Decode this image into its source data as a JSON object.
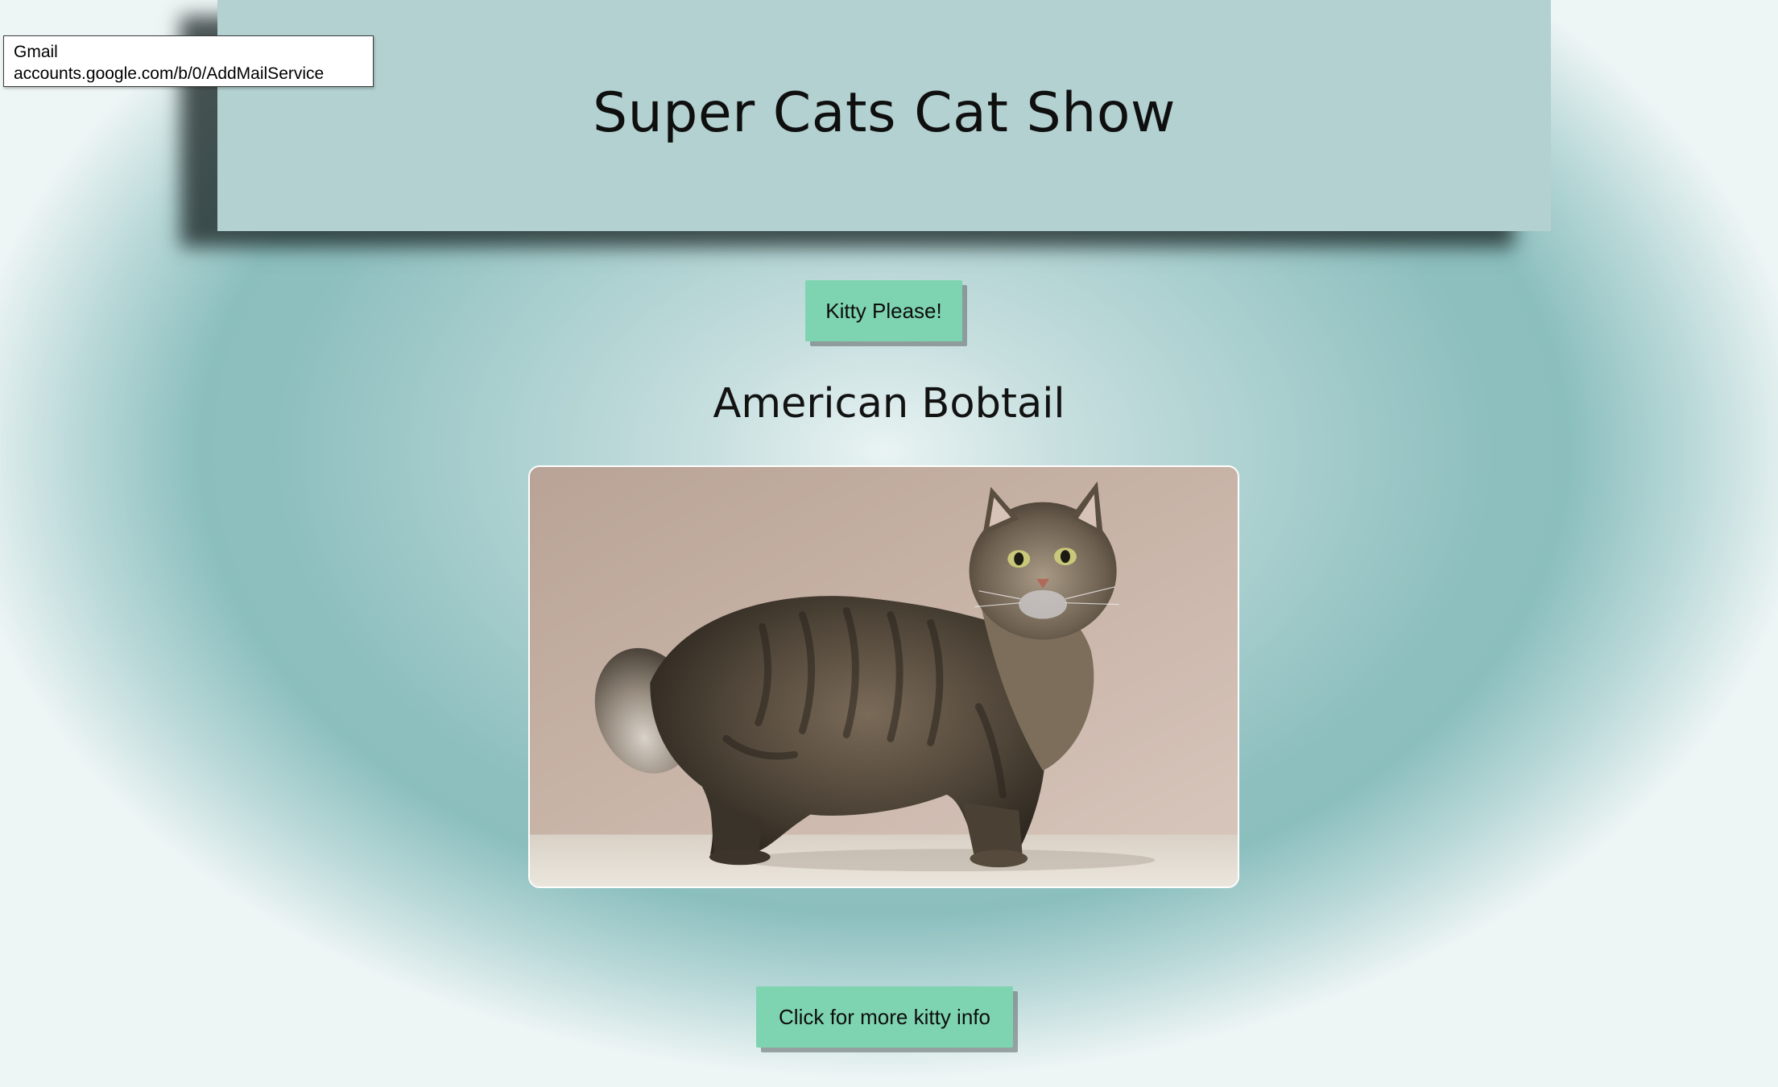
{
  "tooltip": {
    "title": "Gmail",
    "url": "accounts.google.com/b/0/AddMailService"
  },
  "header": {
    "title": "Super Cats Cat Show"
  },
  "buttons": {
    "kitty_please": "Kitty Please!",
    "more_info": "Click for more kitty info"
  },
  "cat": {
    "breed": "American Bobtail",
    "photo_icon": "cat-photo"
  },
  "colors": {
    "header_bg": "#b3d1d0",
    "button_bg": "#7ed4b1",
    "background_center": "#e9f3f3",
    "background_ring": "#8dbfbe"
  }
}
